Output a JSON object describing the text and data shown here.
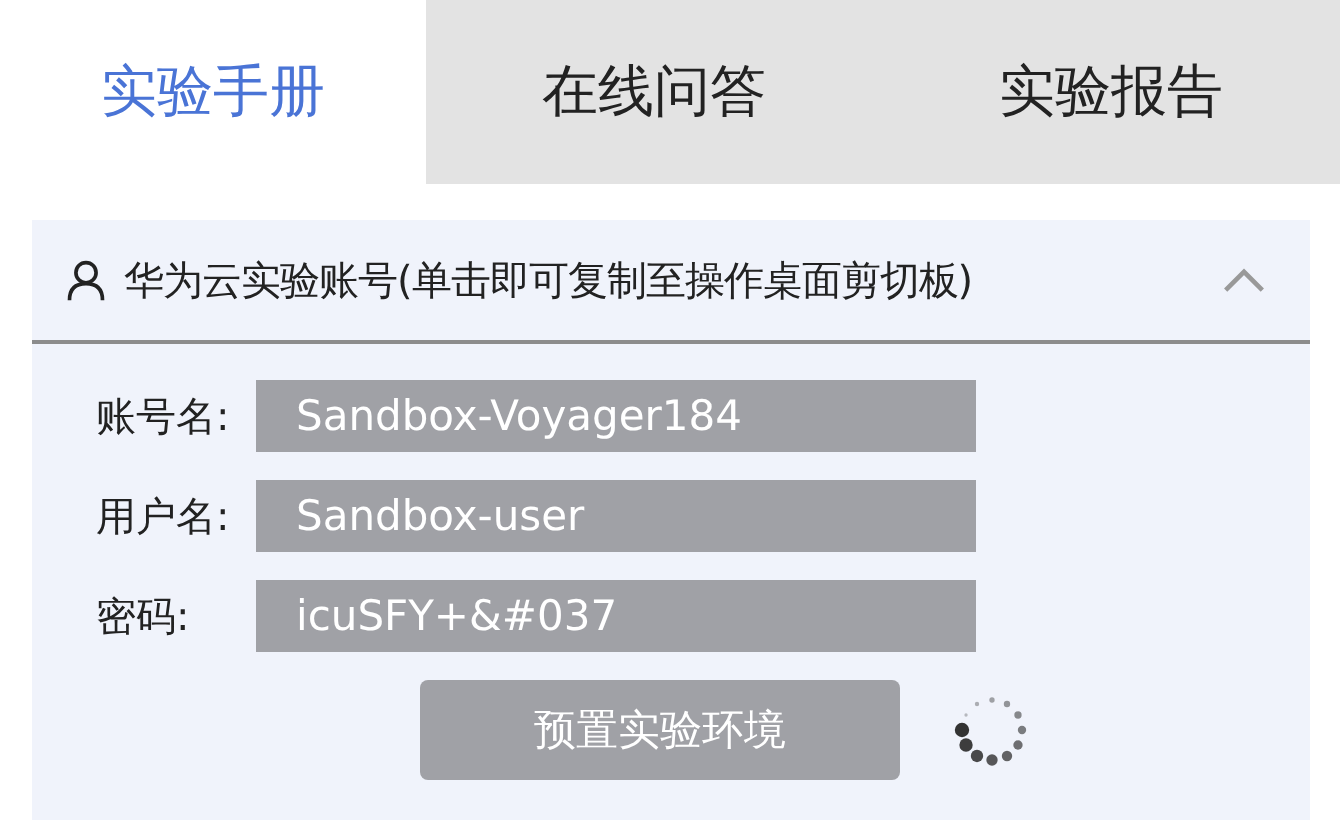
{
  "tabs": [
    {
      "label": "实验手册",
      "selected": true
    },
    {
      "label": "在线问答",
      "selected": false
    },
    {
      "label": "实验报告",
      "selected": false
    }
  ],
  "account_panel": {
    "title": "华为云实验账号(单击即可复制至操作桌面剪切板)",
    "expanded": true,
    "fields": [
      {
        "label": "账号名:",
        "value": "Sandbox-Voyager184"
      },
      {
        "label": "用户名:",
        "value": "Sandbox-user"
      },
      {
        "label": "密码:",
        "value": "icuSFY+&#037"
      }
    ],
    "button": "预置实验环境"
  }
}
